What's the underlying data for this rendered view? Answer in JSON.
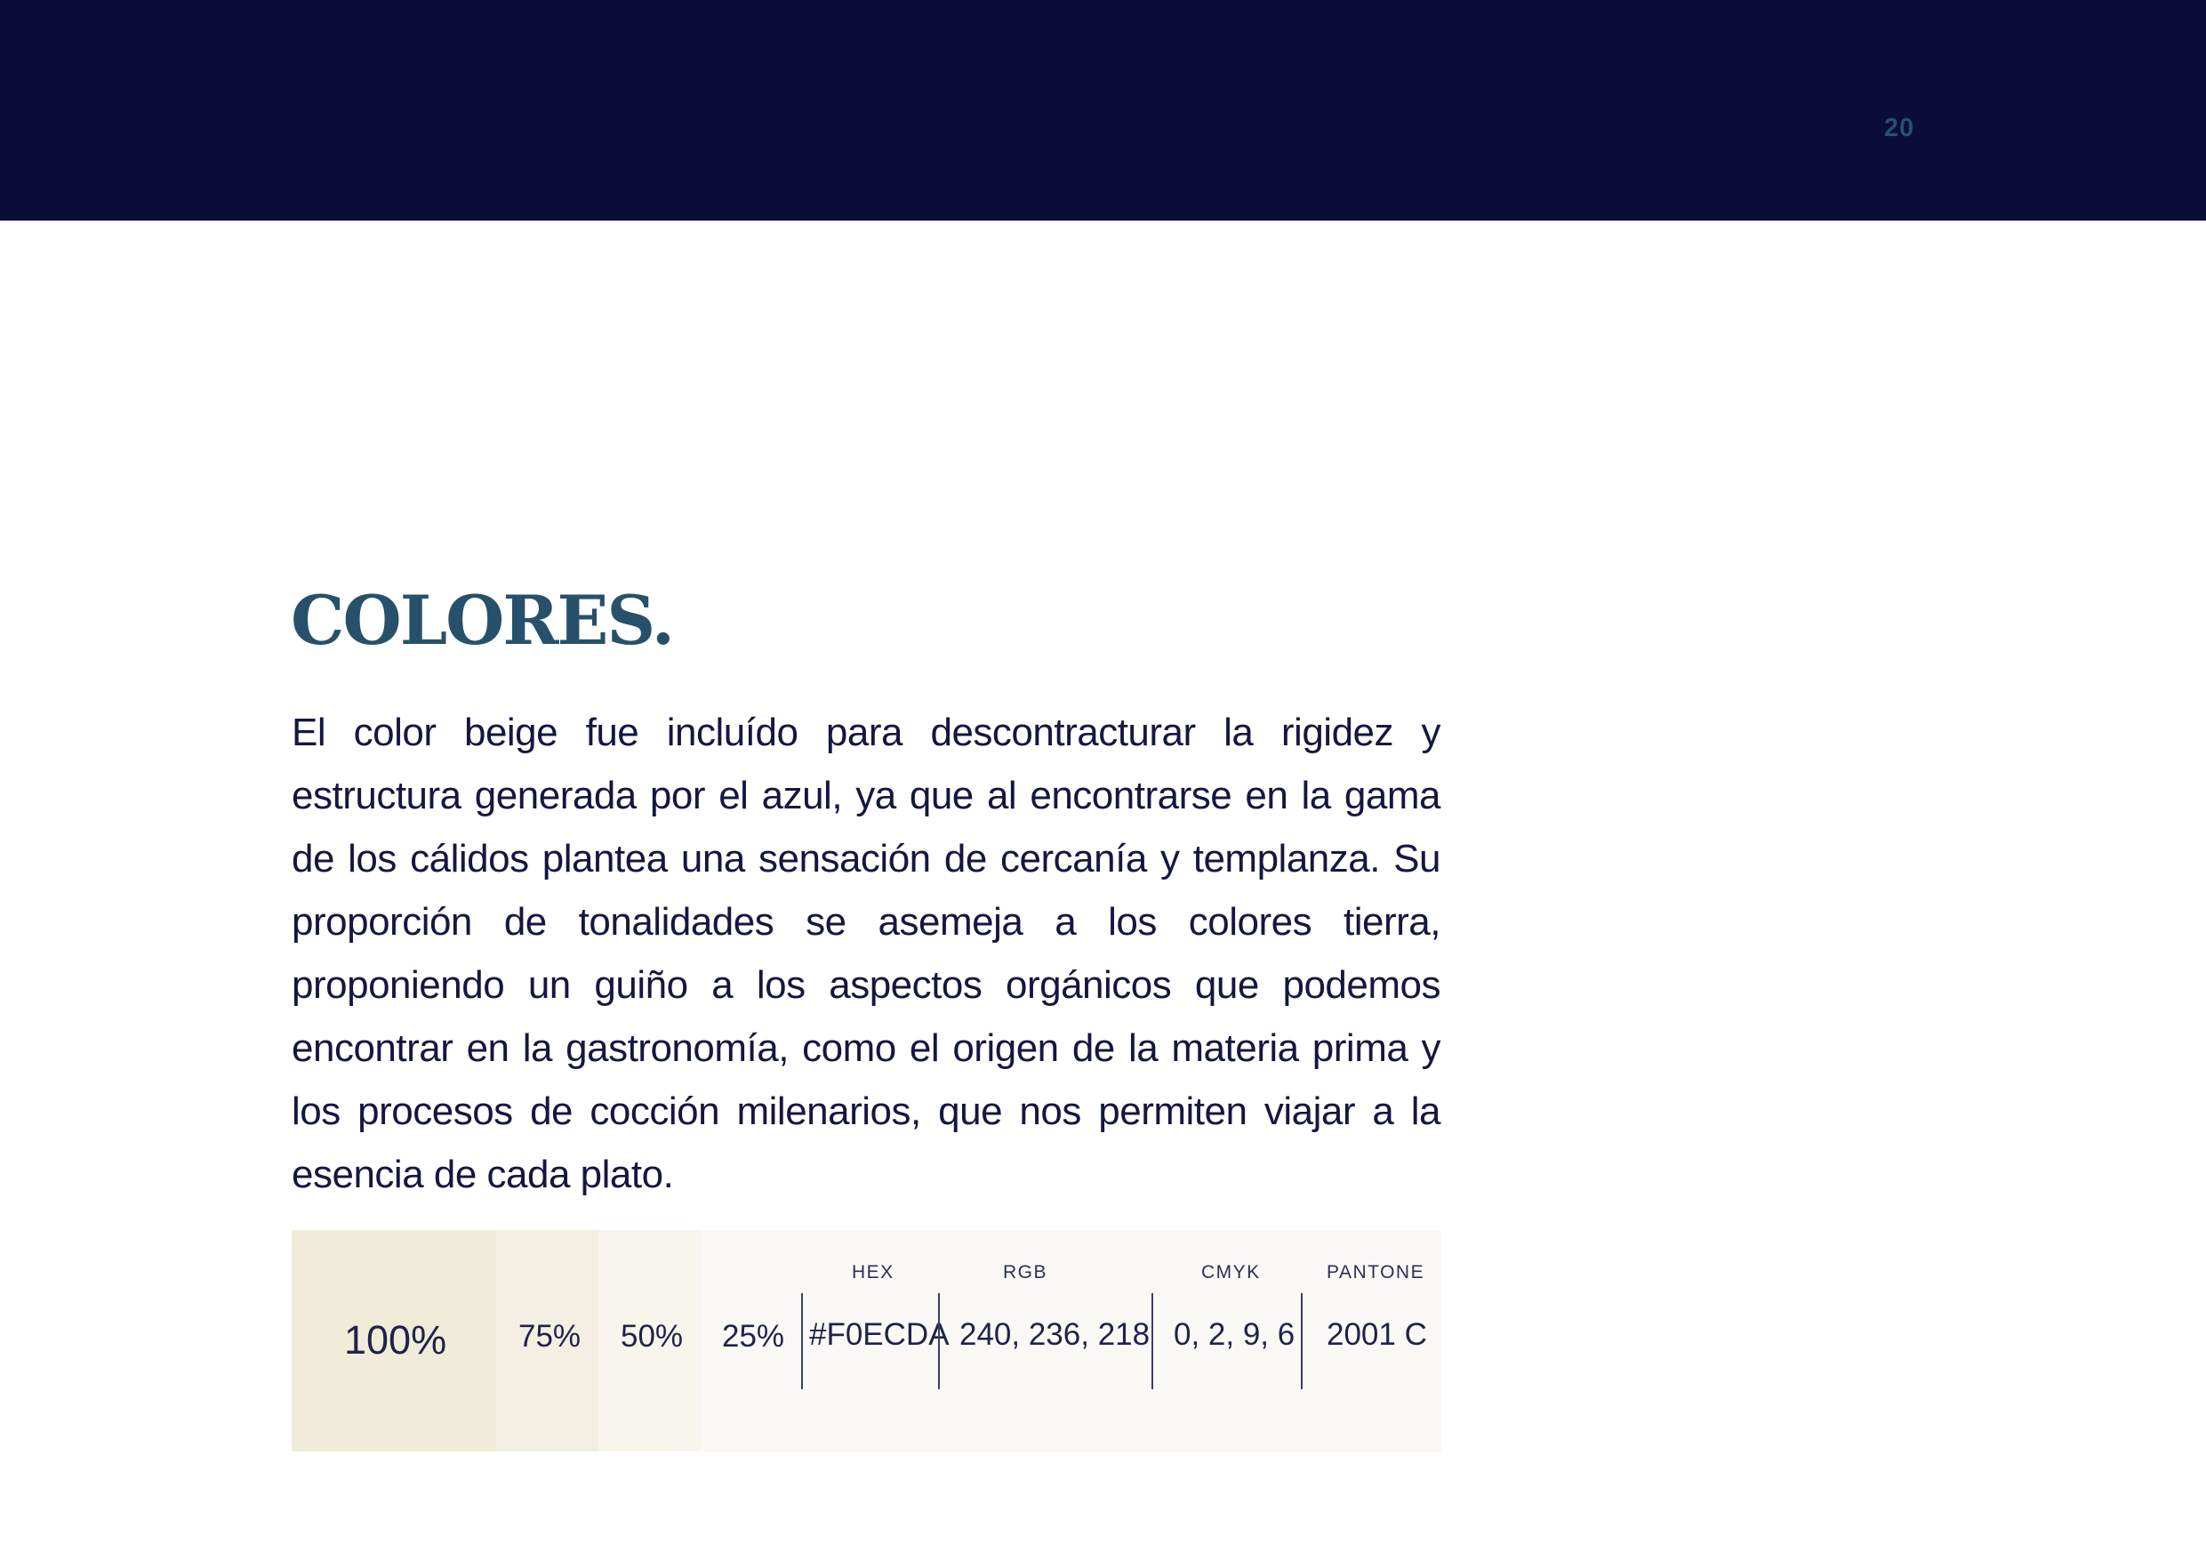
{
  "header": {
    "page_number": "20"
  },
  "content": {
    "title": "COLORES.",
    "paragraph": "El color beige fue incluído para descontracturar la rigidez y estructura generada por el azul, ya que al encontrarse en la gama de los cálidos plantea una sensación de cercanía y templanza. Su proporción de tonalidades se asemeja a los colores tierra, proponiendo un guiño a los aspectos orgánicos que podemos encontrar en la gastronomía, como el origen de la materia prima y los procesos de cocción milenarios, que nos permiten viajar a la esencia de cada plato."
  },
  "swatch": {
    "tints": [
      {
        "label": "100%",
        "color": "#F0ECDA"
      },
      {
        "label": "75%",
        "color": "#F3EFE3"
      },
      {
        "label": "50%",
        "color": "#F7F5EC"
      },
      {
        "label": "25%",
        "color": "#FAF9F6"
      }
    ],
    "specs": {
      "hex_label": "HEX",
      "hex_value": "#F0ECDA",
      "rgb_label": "RGB",
      "rgb_value": "240, 236, 218",
      "cmyk_label": "CMYK",
      "cmyk_value": "0, 2, 9, 6",
      "pantone_label": "PANTONE",
      "pantone_value": "2001 C"
    }
  },
  "colors": {
    "navy": "#0A0C3A",
    "teal_title": "#27516A",
    "beige": "#F0ECDA"
  }
}
